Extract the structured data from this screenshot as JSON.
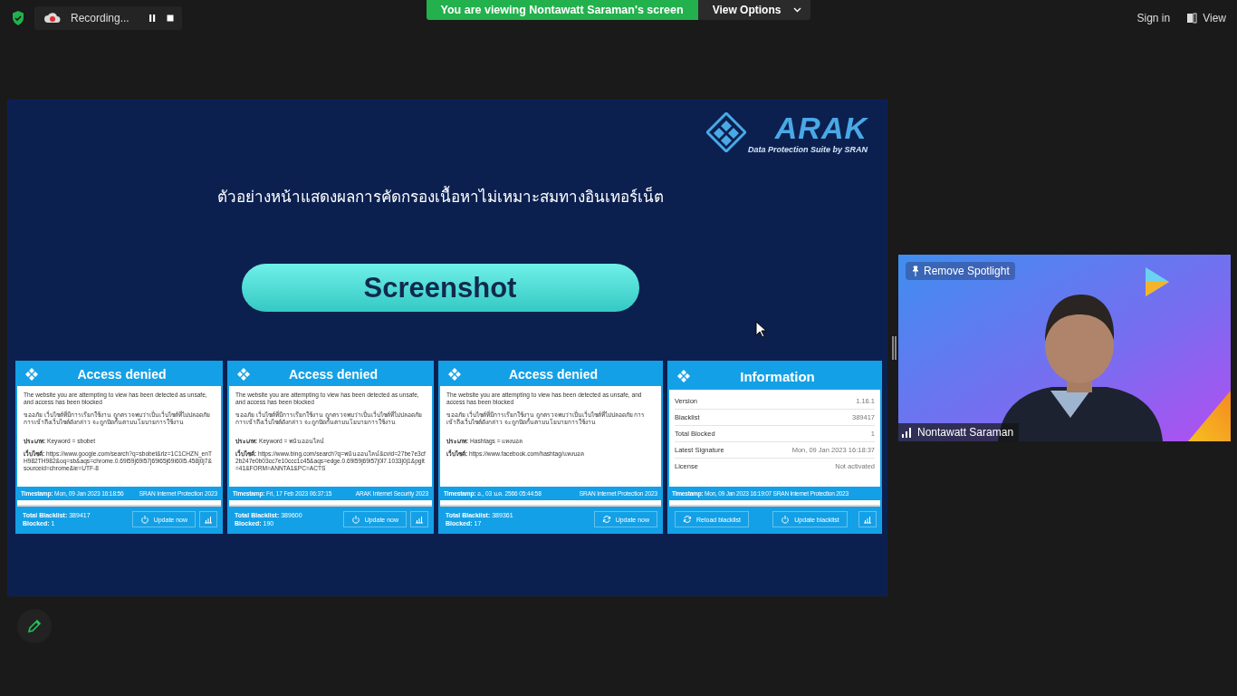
{
  "top_bar": {
    "recording": {
      "label": "Recording..."
    },
    "viewing_banner": "You are viewing Nontawatt Saraman's screen",
    "view_options": "View Options",
    "sign_in": "Sign in",
    "view": "View"
  },
  "shared_screen": {
    "logo": {
      "name": "ARAK",
      "tagline": "Data Protection Suite by SRAN"
    },
    "title": "ตัวอย่างหน้าแสดงผลการคัดกรองเนื้อหาไม่เหมาะสมทางอินเทอร์เน็ต",
    "heading": "Screenshot",
    "cards": [
      {
        "kind": "denied",
        "title": "Access denied",
        "message_en": "The website you are attempting to view has been detected as unsafe, and access has been blocked",
        "message_th": "ขออภัย เว็บไซต์ที่มีการเรียกใช้งาน ถูกตรวจพบว่าเป็นเว็บไซต์ที่ไม่ปลอดภัย การเข้าถึงเว็บไซต์ดังกล่าว จะถูกปิดกั้นตามนโยบายการใช้งาน",
        "type": "**ประเภท:** Keyword = sbobet",
        "site": "**เว็บไซต์:** https://www.google.com/search?q=sbobet&rlz=1C1CHZN_enTH982TH982&oq=sb&aqs=chrome.0.69i59j69i57j69i65j69i60l5.458j0j7&sourceid=chrome&ie=UTF-8",
        "timestamp": "**Timestamp:** Mon, 09 Jan 2023 16:18:56",
        "product": "SRAN Internet Protection 2023",
        "totals": [
          "**Total Blacklist:** 389417",
          "**Blocked:** 1"
        ],
        "buttons": [
          {
            "kind": "update",
            "label": "Update now"
          },
          {
            "kind": "stats"
          }
        ]
      },
      {
        "kind": "denied",
        "title": "Access denied",
        "message_en": "The website you are attempting to view has been detected as unsafe, and access has been blocked",
        "message_th": "ขออภัย เว็บไซต์ที่มีการเรียกใช้งาน ถูกตรวจพบว่าเป็นเว็บไซต์ที่ไม่ปลอดภัย การเข้าถึงเว็บไซต์ดังกล่าว จะถูกปิดกั้นตามนโยบายการใช้งาน",
        "type": "**ประเภท:** Keyword = พนันออนไลน์",
        "site": "**เว็บไซต์:** https://www.bing.com/search?q=พนันออนไลน์&cvid=27be7e3cf2b247e0b03cc7e10ccc1c45&aqs=edge.0.69i59j69i57j0l7.1033j0j1&pglt=41&FORM=ANNTA1&PC=ACTS",
        "timestamp": "**Timestamp:** Fri, 17 Feb 2023 06:37:15",
        "product": "ARAK Internet Security 2023",
        "totals": [
          "**Total Blacklist:** 389600",
          "**Blocked:** 190"
        ],
        "buttons": [
          {
            "kind": "update",
            "label": "Update now"
          },
          {
            "kind": "stats"
          }
        ]
      },
      {
        "kind": "denied",
        "title": "Access denied",
        "message_en": "The website you are attempting to view has been detected as unsafe, and access has been blocked",
        "message_th": "ขออภัย เว็บไซต์ที่มีการเรียกใช้งาน ถูกตรวจพบว่าเป็นเว็บไซต์ที่ไม่ปลอดภัย การเข้าถึงเว็บไซต์ดังกล่าว จะถูกปิดกั้นตามนโยบายการใช้งาน",
        "type": "**ประเภท:** Hashtags = แทงบอล",
        "site": "**เว็บไซต์:** https://www.facebook.com/hashtag/แทงบอล",
        "timestamp": "**Timestamp:** อ., 03 ม.ค. 2566 05:44:58",
        "product": "SRAN Internet Protection 2023",
        "totals": [
          "**Total Blacklist:** 389361",
          "**Blocked:** 17"
        ],
        "buttons": [
          {
            "kind": "sync",
            "label": "Update now"
          }
        ]
      },
      {
        "kind": "info",
        "title": "Information",
        "rows": [
          {
            "label": "Version",
            "value": "1.16.1"
          },
          {
            "label": "Blacklist",
            "value": "389417"
          },
          {
            "label": "Total Blocked",
            "value": "1"
          },
          {
            "label": "Latest Signature",
            "value": "Mon, 09 Jan 2023 16:18:37"
          },
          {
            "label": "License",
            "value": "Not activated"
          }
        ],
        "timestamp": "**Timestamp:** Mon, 09 Jan 2023 16:19:07 SRAN Internet Protection 2023",
        "buttons": [
          {
            "kind": "sync",
            "label": "Reload blacklist"
          },
          {
            "kind": "update",
            "label": "Update blacklist"
          },
          {
            "kind": "stats"
          }
        ]
      }
    ]
  },
  "video": {
    "remove_spotlight": "Remove Spotlight",
    "participant": "Nontawatt Saraman"
  }
}
